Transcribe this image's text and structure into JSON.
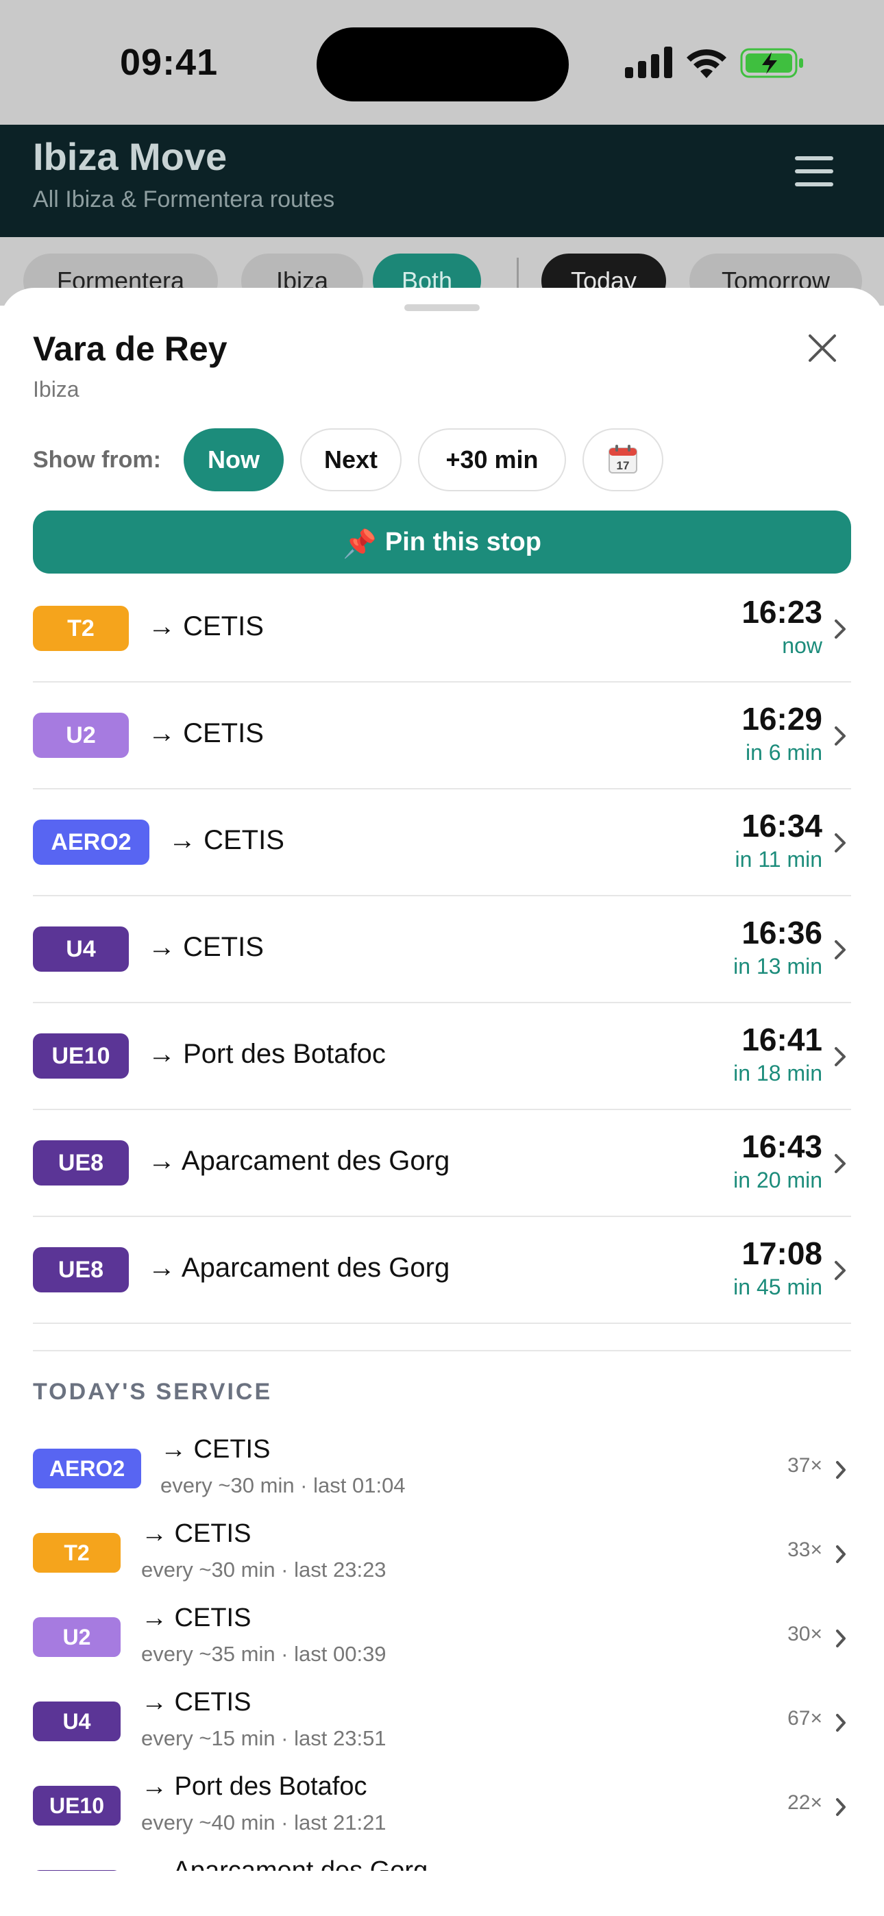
{
  "status_bar": {
    "time": "09:41"
  },
  "header": {
    "title": "Ibiza Move",
    "subtitle": "All Ibiza & Formentera routes"
  },
  "filters": {
    "islands": [
      "Formentera",
      "Ibiza",
      "Both"
    ],
    "selected_island": "Both",
    "days": [
      "Today",
      "Tomorrow"
    ],
    "selected_day": "Today"
  },
  "stop": {
    "name": "Vara de Rey",
    "region": "Ibiza"
  },
  "show_from": {
    "label": "Show from:",
    "options": [
      "Now",
      "Next",
      "+30 min"
    ],
    "selected": "Now",
    "calendar_icon": "calendar-icon",
    "calendar_day": "17"
  },
  "pin": {
    "icon": "📌",
    "label": "Pin this stop"
  },
  "departures": [
    {
      "route": "T2",
      "color": "#f5a41c",
      "destination": "→ CETIS",
      "time": "16:23",
      "relative": "now"
    },
    {
      "route": "U2",
      "color": "#a67be0",
      "destination": "→ CETIS",
      "time": "16:29",
      "relative": "in 6 min"
    },
    {
      "route": "AERO2",
      "color": "#5865f2",
      "destination": "→ CETIS",
      "time": "16:34",
      "relative": "in 11 min"
    },
    {
      "route": "U4",
      "color": "#5b3596",
      "destination": "→ CETIS",
      "time": "16:36",
      "relative": "in 13 min"
    },
    {
      "route": "UE10",
      "color": "#5b3596",
      "destination": "→ Port des Botafoc",
      "time": "16:41",
      "relative": "in 18 min"
    },
    {
      "route": "UE8",
      "color": "#5b3596",
      "destination": "→ Aparcament des Gorg",
      "time": "16:43",
      "relative": "in 20 min"
    },
    {
      "route": "UE8",
      "color": "#5b3596",
      "destination": "→ Aparcament des Gorg",
      "time": "17:08",
      "relative": "in 45 min"
    }
  ],
  "todays_service": {
    "title": "TODAY'S SERVICE",
    "items": [
      {
        "route": "AERO2",
        "color": "#5865f2",
        "destination": "→ CETIS",
        "meta": "every ~30 min · last 01:04",
        "count": "37×"
      },
      {
        "route": "T2",
        "color": "#f5a41c",
        "destination": "→ CETIS",
        "meta": "every ~30 min · last 23:23",
        "count": "33×"
      },
      {
        "route": "U2",
        "color": "#a67be0",
        "destination": "→ CETIS",
        "meta": "every ~35 min · last 00:39",
        "count": "30×"
      },
      {
        "route": "U4",
        "color": "#5b3596",
        "destination": "→ CETIS",
        "meta": "every ~15 min · last 23:51",
        "count": "67×"
      },
      {
        "route": "UE10",
        "color": "#5b3596",
        "destination": "→ Port des Botafoc",
        "meta": "every ~40 min · last 21:21",
        "count": "22×"
      },
      {
        "route": "",
        "color": "#5b3596",
        "destination": "→ Aparcament des Gorg",
        "meta": "",
        "count": ""
      }
    ]
  }
}
